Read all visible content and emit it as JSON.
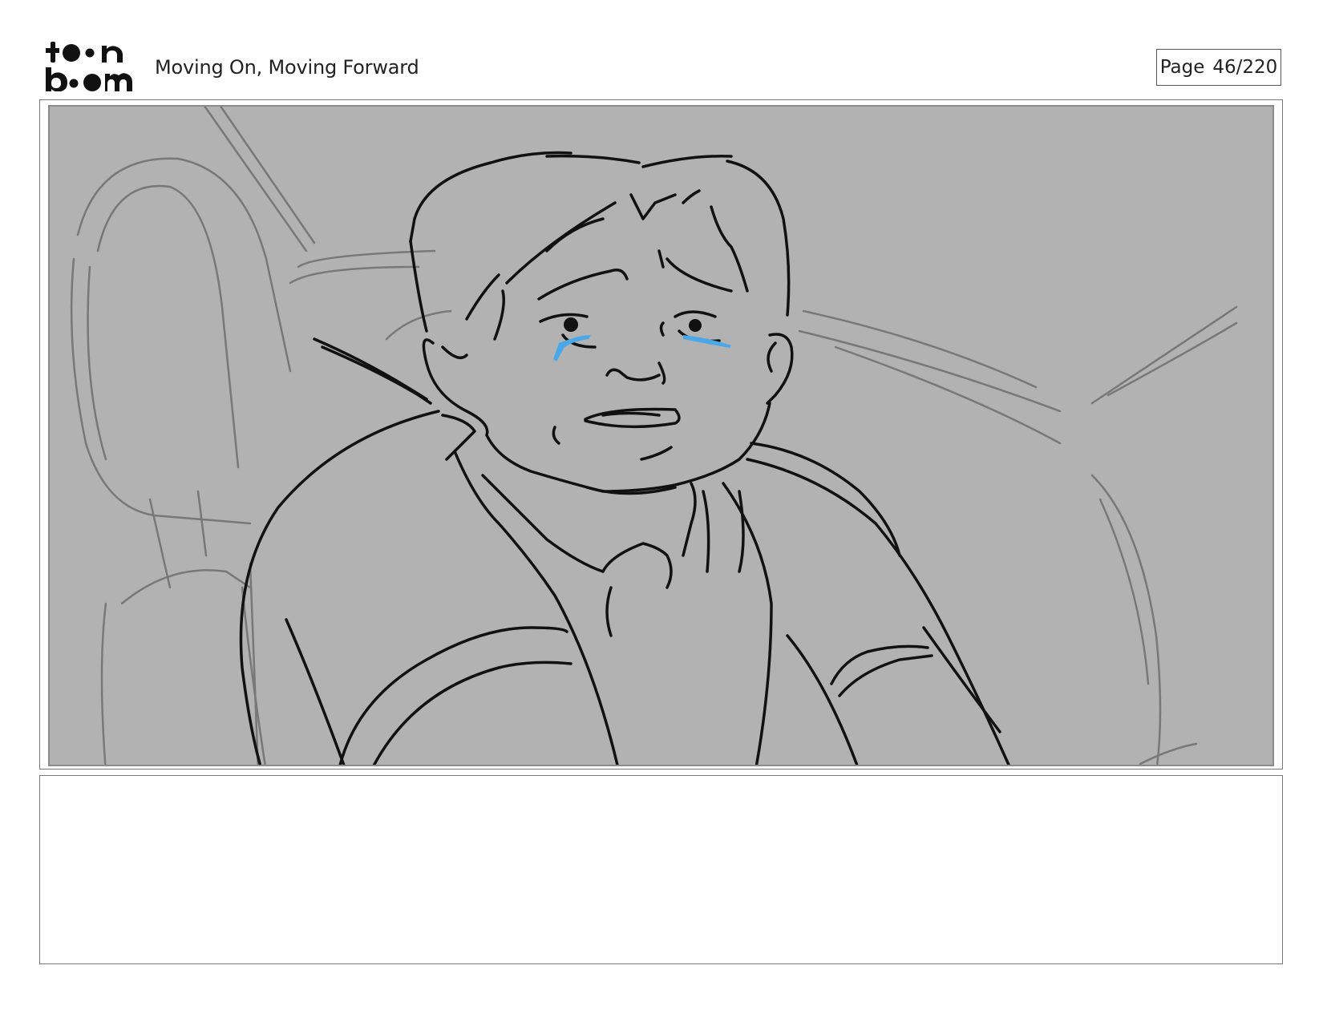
{
  "header": {
    "logo_text": "toonboom",
    "project_title": "Moving On, Moving Forward",
    "page_label": "Page",
    "page_number": "46/220"
  },
  "panel": {
    "background_color": "#b2b2b2",
    "line_color": "#111111",
    "tear_color": "#4aa8e8"
  },
  "notes": {
    "text": ""
  }
}
